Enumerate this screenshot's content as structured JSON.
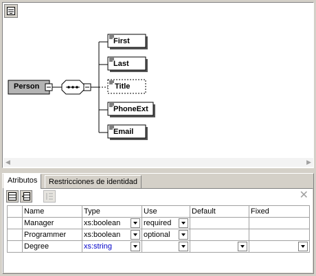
{
  "diagram": {
    "root": "Person",
    "children": [
      "First",
      "Last",
      "Title",
      "PhoneExt",
      "Email"
    ],
    "optional_child": "Title",
    "compositor_icon": "sequence-icon"
  },
  "tabs": [
    {
      "label": "Atributos",
      "active": true
    },
    {
      "label": "Restricciones de identidad",
      "active": false
    }
  ],
  "attributes": {
    "columns": [
      "Name",
      "Type",
      "Use",
      "Default",
      "Fixed"
    ],
    "rows": [
      {
        "name": "Manager",
        "type": "xs:boolean",
        "use": "required",
        "default": "",
        "fixed": ""
      },
      {
        "name": "Programmer",
        "type": "xs:boolean",
        "use": "optional",
        "default": "",
        "fixed": ""
      },
      {
        "name": "Degree",
        "type": "xs:string",
        "use": "",
        "default": "",
        "fixed": ""
      }
    ]
  },
  "colors": {
    "root_fill": "#b4b4b4",
    "chrome": "#d4d0c8",
    "selected_type": "#0000c8"
  }
}
